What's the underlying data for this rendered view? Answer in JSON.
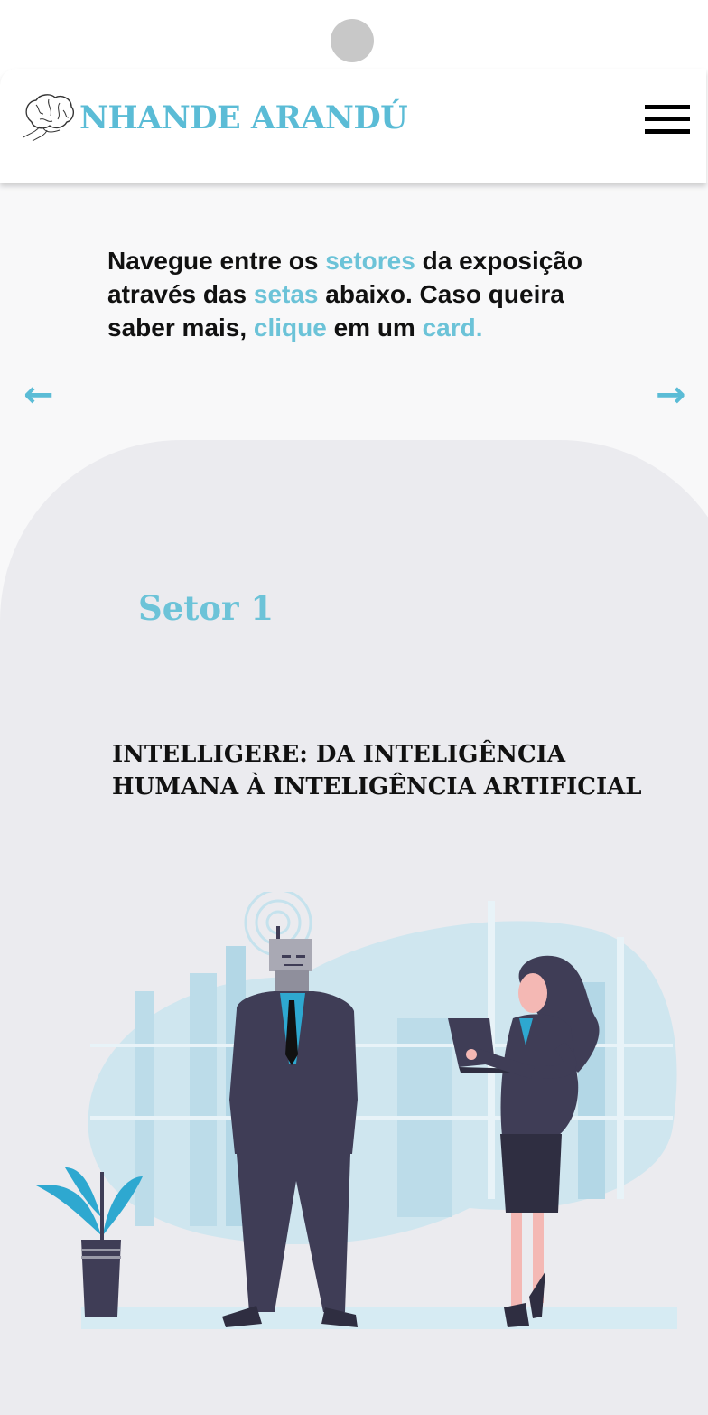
{
  "header": {
    "brand": "NHANDE ARANDÚ",
    "logo_icon": "brain-logo-icon",
    "menu_icon": "hamburger-menu-icon"
  },
  "intro": {
    "line1_a": "Navegue entre os ",
    "line1_hl": "setores",
    "line1_b": " da exposição",
    "line2_a": "através das ",
    "line2_hl": "setas",
    "line2_b": " abaixo. Caso queira",
    "line3_a": "saber mais, ",
    "line3_hl": "clique",
    "line3_b": " em um ",
    "line3_hl2": "card."
  },
  "nav": {
    "prev_arrow": "←",
    "next_arrow": "→"
  },
  "card": {
    "sector": "Setor 1",
    "title": "INTELLIGERE: DA INTELIGÊNCIA HUMANA À INTELIGÊNCIA ARTIFICIAL",
    "illustration": "robot-businessman-and-woman-with-laptop-illustration"
  },
  "colors": {
    "accent": "#5bbcd6",
    "card_bg": "#ebebef",
    "figure_dark": "#3f3d56",
    "figure_accent": "#2ea8d0"
  }
}
